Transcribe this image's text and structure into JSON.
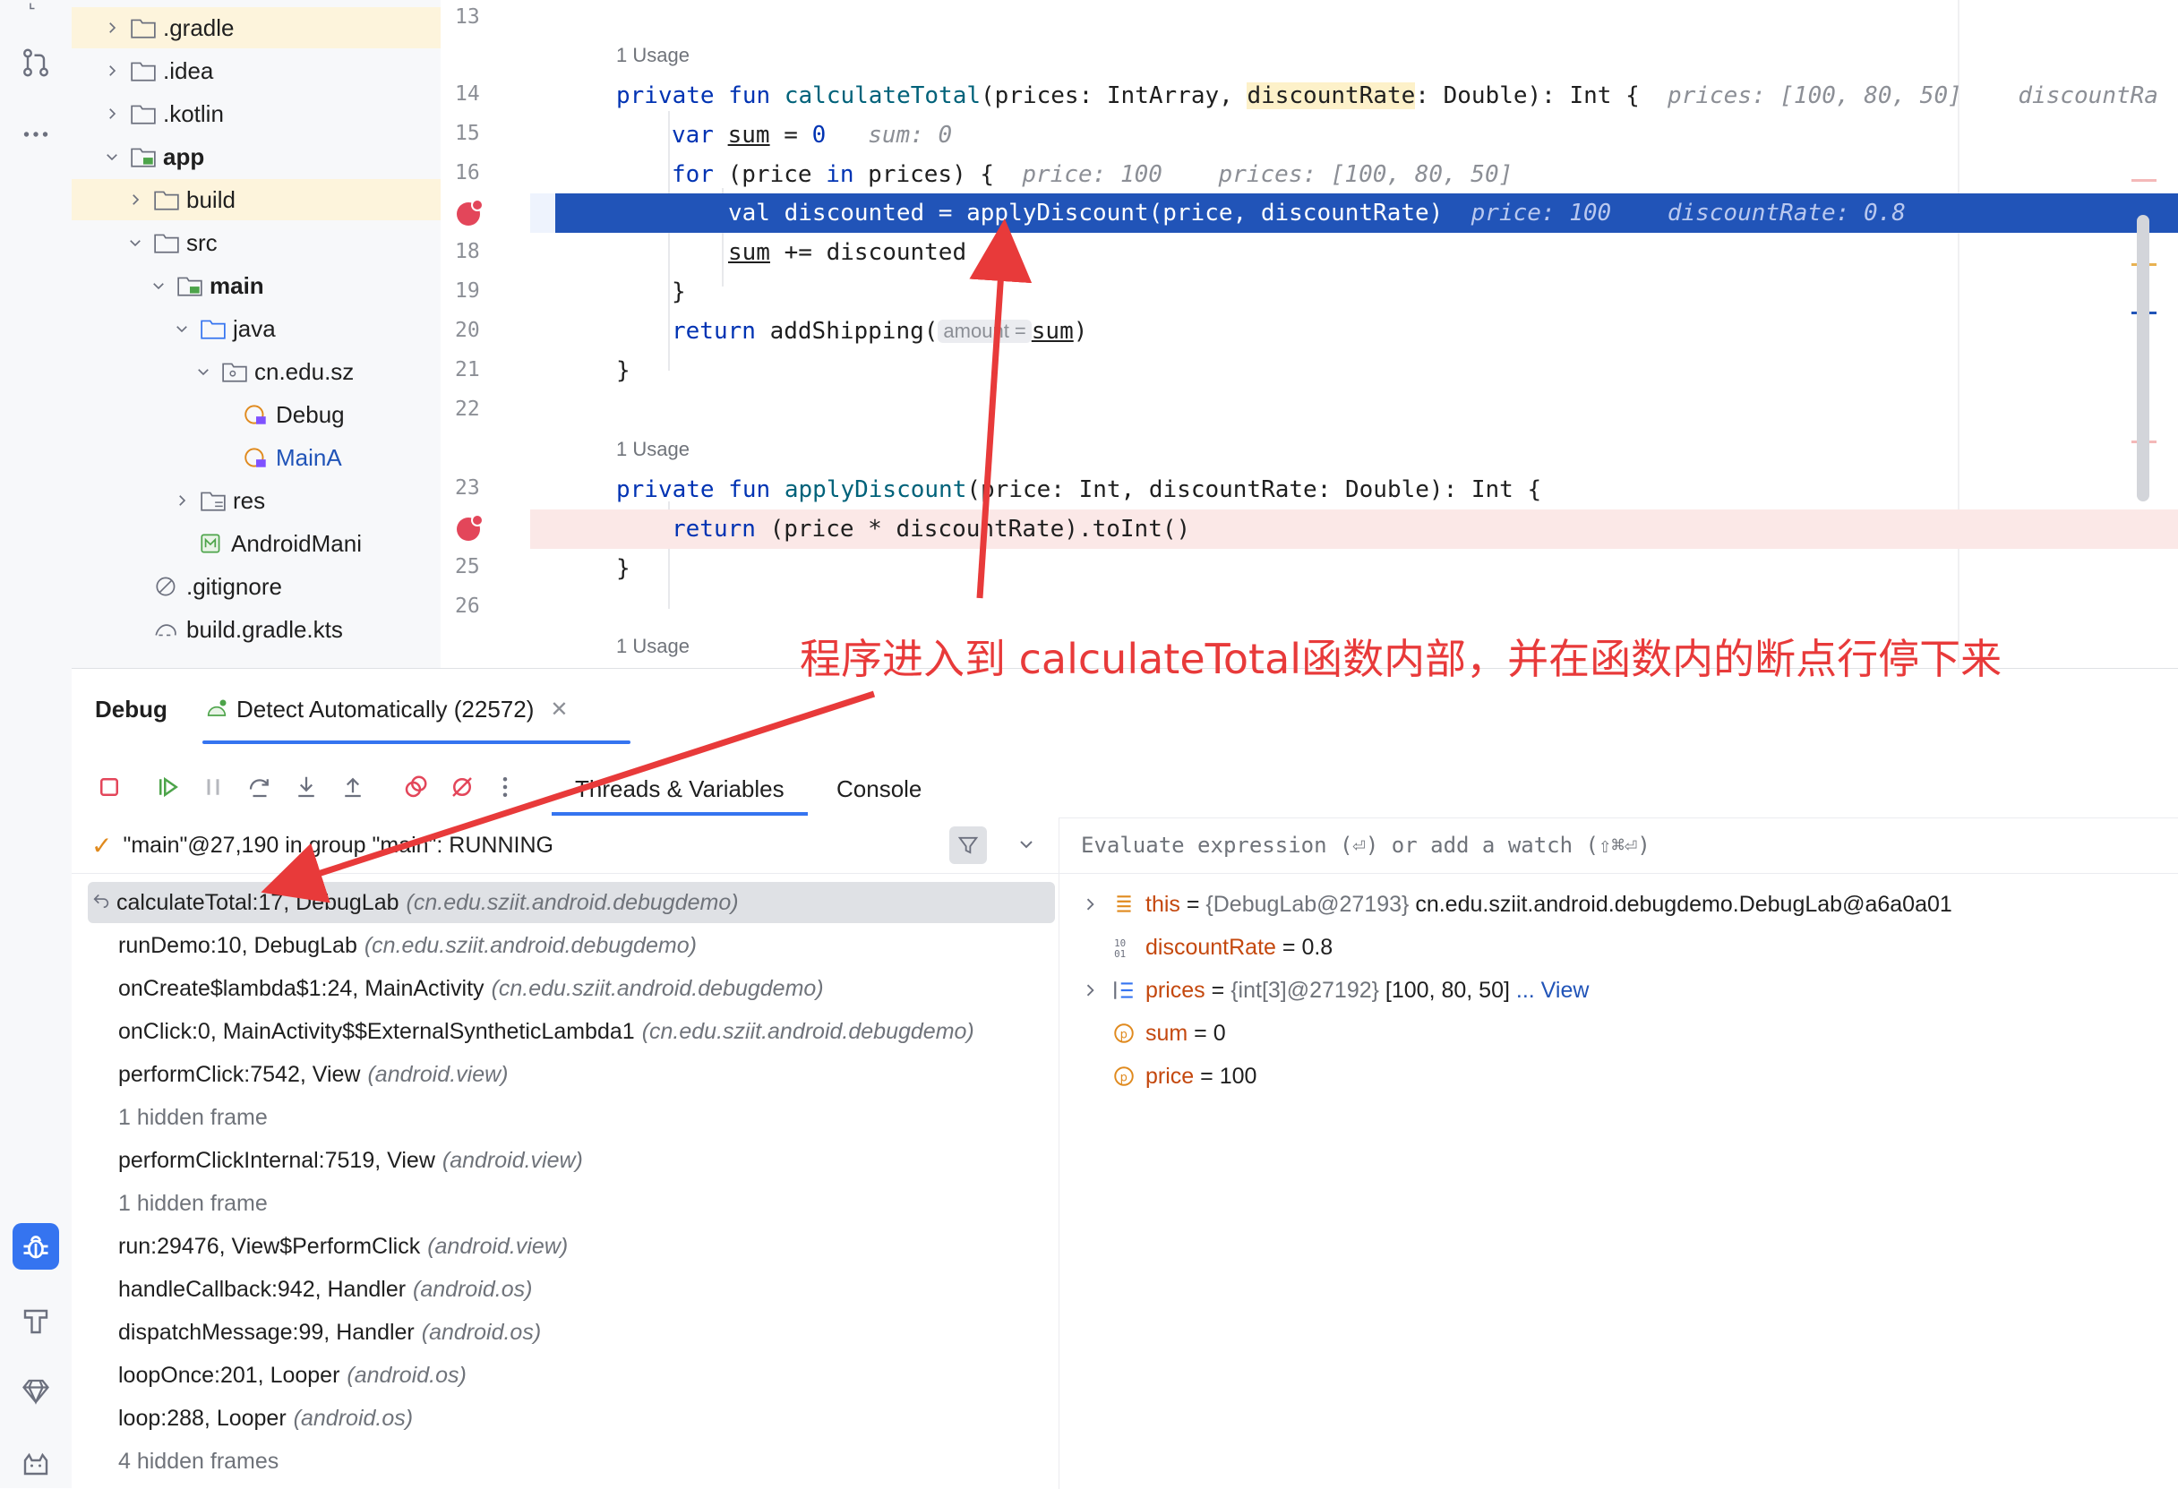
{
  "project_tree": [
    {
      "label": ".gradle",
      "kind": "folder",
      "chevron": "right",
      "highlight": true
    },
    {
      "label": ".idea",
      "kind": "folder",
      "chevron": "right"
    },
    {
      "label": ".kotlin",
      "kind": "folder",
      "chevron": "right"
    },
    {
      "label": "app",
      "kind": "module",
      "chevron": "down",
      "bold": true
    },
    {
      "label": "build",
      "kind": "folder",
      "chevron": "right",
      "highlight": true
    },
    {
      "label": "src",
      "kind": "folder",
      "chevron": "down"
    },
    {
      "label": "main",
      "kind": "module",
      "chevron": "down",
      "bold": true
    },
    {
      "label": "java",
      "kind": "source-folder",
      "chevron": "down"
    },
    {
      "label": "cn.edu.sz",
      "kind": "package",
      "chevron": "down"
    },
    {
      "label": "Debug",
      "kind": "kotlin-class"
    },
    {
      "label": "MainA",
      "kind": "kotlin-class",
      "accent": true
    },
    {
      "label": "res",
      "kind": "res-folder",
      "chevron": "right"
    },
    {
      "label": "AndroidMani",
      "kind": "manifest"
    },
    {
      "label": ".gitignore",
      "kind": "ignore"
    },
    {
      "label": "build.gradle.kts",
      "kind": "gradle"
    }
  ],
  "editor": {
    "line_numbers": [
      "13",
      "14",
      "15",
      "16",
      "17",
      "18",
      "19",
      "20",
      "21",
      "22",
      "23",
      "24",
      "25",
      "26"
    ],
    "usage_label": "1 Usage",
    "line14": {
      "kw1": "private",
      "kw2": "fun",
      "fn": "calculateTotal",
      "p1": "(prices: IntArray, ",
      "p2": "discountRate",
      "p3": ": Double): Int {",
      "hint1": "prices: [100, 80, 50]",
      "hint2": "discountRa"
    },
    "line15": {
      "kw": "var",
      "var": "sum",
      "rest": " = ",
      "num": "0",
      "hint": "sum: 0"
    },
    "line16": {
      "kw": "for",
      "p1": " (price ",
      "kw2": "in",
      "p2": " prices) {",
      "hint1": "price: 100",
      "hint2": "prices: [100, 80, 50]"
    },
    "line17": {
      "code": "val discounted = applyDiscount(price, discountRate)",
      "hint1": "price: 100",
      "hint2": "discountRate: 0.8"
    },
    "line18": {
      "var": "sum",
      "rest": " += discounted"
    },
    "line19": "}",
    "line20": {
      "kw": "return",
      "p1": " addShipping(",
      "inlay": "amount =",
      "var": "sum",
      "p2": ")"
    },
    "line21": "}",
    "line23": {
      "kw1": "private",
      "kw2": "fun",
      "fn": "applyDiscount",
      "rest": "(price: Int, discountRate: Double): Int {"
    },
    "line24": {
      "kw": "return",
      "rest": " (price * discountRate).toInt()"
    },
    "line25": "}"
  },
  "debug": {
    "title": "Debug",
    "session_tab": "Detect Automatically (22572)",
    "tabs": [
      "Threads & Variables",
      "Console"
    ],
    "thread_status": "\"main\"@27,190 in group \"main\": RUNNING",
    "eval_placeholder": "Evaluate expression (⏎) or add a watch (⇧⌘⏎)",
    "frames": [
      {
        "method": "calculateTotal:17, DebugLab",
        "pkg": "(cn.edu.sziit.android.debugdemo)",
        "selected": true
      },
      {
        "method": "runDemo:10, DebugLab",
        "pkg": "(cn.edu.sziit.android.debugdemo)"
      },
      {
        "method": "onCreate$lambda$1:24, MainActivity",
        "pkg": "(cn.edu.sziit.android.debugdemo)"
      },
      {
        "method": "onClick:0, MainActivity$$ExternalSyntheticLambda1",
        "pkg": "(cn.edu.sziit.android.debugdemo)"
      },
      {
        "method": "performClick:7542, View",
        "pkg": "(android.view)"
      },
      {
        "method": "1 hidden frame",
        "pkg": "",
        "hidden": true
      },
      {
        "method": "performClickInternal:7519, View",
        "pkg": "(android.view)"
      },
      {
        "method": "1 hidden frame",
        "pkg": "",
        "hidden": true
      },
      {
        "method": "run:29476, View$PerformClick",
        "pkg": "(android.view)"
      },
      {
        "method": "handleCallback:942, Handler",
        "pkg": "(android.os)"
      },
      {
        "method": "dispatchMessage:99, Handler",
        "pkg": "(android.os)"
      },
      {
        "method": "loopOnce:201, Looper",
        "pkg": "(android.os)"
      },
      {
        "method": "loop:288, Looper",
        "pkg": "(android.os)"
      },
      {
        "method": "4 hidden frames",
        "pkg": "",
        "hidden": true
      }
    ],
    "variables": [
      {
        "name": "this",
        "eq": " = ",
        "type": "{DebugLab@27193}",
        "value": " cn.edu.sziit.android.debugdemo.DebugLab@a6a0a01",
        "icon": "object-icon",
        "expandable": true
      },
      {
        "name": "discountRate",
        "eq": " = ",
        "type": "",
        "value": "0.8",
        "icon": "primitive-icon",
        "expandable": false
      },
      {
        "name": "prices",
        "eq": " = ",
        "type": "{int[3]@27192}",
        "value": " [100, 80, 50]",
        "link": " ... View",
        "icon": "array-icon",
        "expandable": true
      },
      {
        "name": "sum",
        "eq": " = ",
        "type": "",
        "value": "0",
        "icon": "local-var-icon",
        "expandable": false
      },
      {
        "name": "price",
        "eq": " = ",
        "type": "",
        "value": "100",
        "icon": "local-var-icon",
        "expandable": false
      }
    ]
  },
  "annotation": {
    "text": "程序进入到 calculateTotal函数内部，并在函数内的断点行停下来",
    "color": "#e83a3a"
  },
  "colors": {
    "execution_line": "#2154b8",
    "breakpoint": "#e3465a",
    "accent": "#3574f0",
    "keyword": "#0033b3",
    "function": "#00627a"
  }
}
